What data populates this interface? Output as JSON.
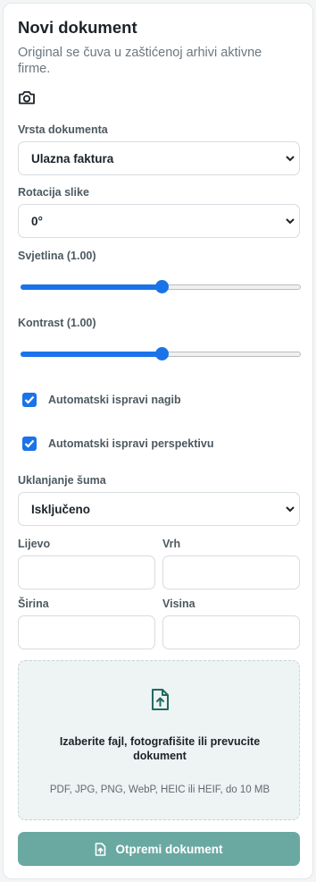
{
  "header": {
    "title": "Novi dokument",
    "subtitle": "Original se čuva u zaštićenoj arhivi aktivne firme.",
    "camera_icon": "camera-icon"
  },
  "form": {
    "document_type": {
      "label": "Vrsta dokumenta",
      "value": "Ulazna faktura"
    },
    "rotation": {
      "label": "Rotacija slike",
      "value": "0°"
    },
    "brightness": {
      "label": "Svjetlina (1.00)",
      "level": 0.5
    },
    "contrast": {
      "label": "Kontrast (1.00)",
      "level": 0.5
    },
    "auto_tilt": {
      "label": "Automatski ispravi nagib",
      "checked": true
    },
    "auto_perspective": {
      "label": "Automatski ispravi perspektivu",
      "checked": true
    },
    "noise": {
      "label": "Uklanjanje šuma",
      "value": "Isključeno"
    },
    "crop": {
      "left_label": "Lijevo",
      "top_label": "Vrh",
      "width_label": "Širina",
      "height_label": "Visina",
      "left_value": "",
      "top_value": "",
      "width_value": "",
      "height_value": ""
    }
  },
  "dropzone": {
    "icon": "file-upload-icon",
    "title": "Izaberite fajl, fotografišite ili prevucite dokument",
    "hint": "PDF, JPG, PNG, WebP, HEIC ili HEIF, do 10 MB"
  },
  "submit": {
    "label": "Otpremi dokument",
    "icon": "upload-icon"
  },
  "colors": {
    "accent": "#1a73e8",
    "brand": "#6aa9a2",
    "icon_teal": "#1f6b62"
  }
}
